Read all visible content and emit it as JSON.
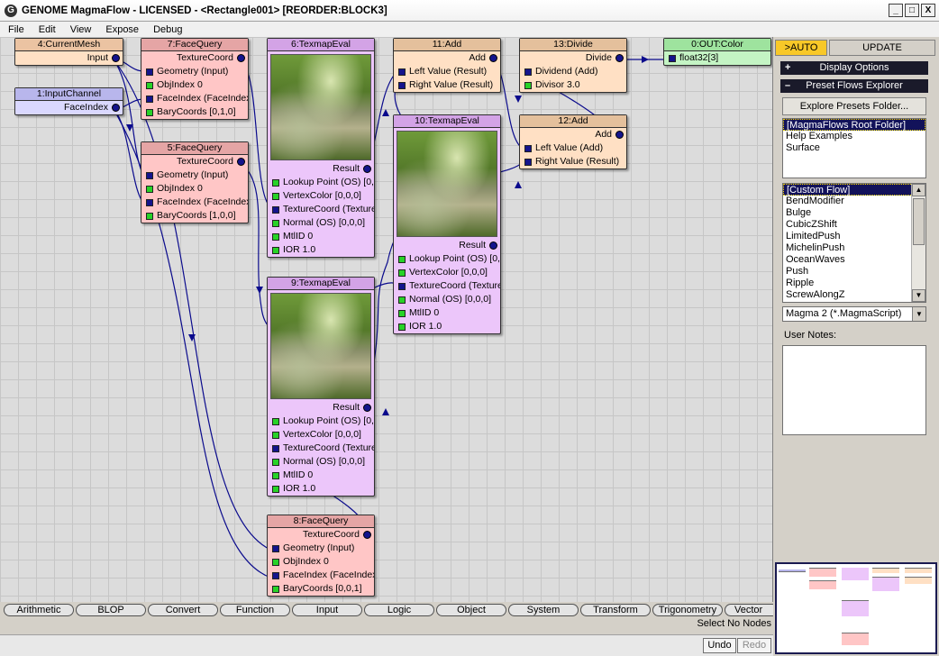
{
  "window": {
    "title": "GENOME MagmaFlow - LICENSED - <Rectangle001> [REORDER:BLOCK3]",
    "app_icon": "G",
    "minimize_glyph": "_",
    "maximize_glyph": "□",
    "close_glyph": "X"
  },
  "menu": [
    "File",
    "Edit",
    "View",
    "Expose",
    "Debug"
  ],
  "colors": {
    "mesh_node": "#ffe0c4",
    "mesh_header": "#ebc3a2",
    "input_node": "#dad8ff",
    "input_header": "#b8b6ec",
    "query_node": "#ffc6c6",
    "query_header": "#e5a5a5",
    "texmap_node": "#ecc6fa",
    "texmap_header": "#d3a3e6",
    "math_node": "#ffe0c4",
    "math_header": "#e4c09c",
    "out_node": "#c4f4c4",
    "out_header": "#9ee39e",
    "wire": "#0a0a8c"
  },
  "nodes": {
    "current_mesh": {
      "title": "4:CurrentMesh",
      "out": "Input"
    },
    "input_channel": {
      "title": "1:InputChannel",
      "out": "FaceIndex"
    },
    "facequery7": {
      "title": "7:FaceQuery",
      "out": "TextureCoord",
      "inputs": [
        {
          "label": "Geometry (Input)",
          "type": "blue"
        },
        {
          "label": "ObjIndex 0",
          "type": "green"
        },
        {
          "label": "FaceIndex (FaceIndex)",
          "type": "blue"
        },
        {
          "label": "BaryCoords [0,1,0]",
          "type": "green"
        }
      ]
    },
    "facequery5": {
      "title": "5:FaceQuery",
      "out": "TextureCoord",
      "inputs": [
        {
          "label": "Geometry (Input)",
          "type": "blue"
        },
        {
          "label": "ObjIndex 0",
          "type": "green"
        },
        {
          "label": "FaceIndex (FaceIndex)",
          "type": "blue"
        },
        {
          "label": "BaryCoords [1,0,0]",
          "type": "green"
        }
      ]
    },
    "facequery8": {
      "title": "8:FaceQuery",
      "out": "TextureCoord",
      "inputs": [
        {
          "label": "Geometry (Input)",
          "type": "blue"
        },
        {
          "label": "ObjIndex 0",
          "type": "green"
        },
        {
          "label": "FaceIndex (FaceIndex)",
          "type": "blue"
        },
        {
          "label": "BaryCoords [0,0,1]",
          "type": "green"
        }
      ]
    },
    "texmap6": {
      "title": "6:TexmapEval",
      "out": "Result",
      "inputs": [
        {
          "label": "Lookup Point (OS) [0,0,0]",
          "type": "green"
        },
        {
          "label": "VertexColor [0,0,0]",
          "type": "green"
        },
        {
          "label": "TextureCoord (TextureCoord)",
          "type": "blue"
        },
        {
          "label": "Normal (OS) [0,0,0]",
          "type": "green"
        },
        {
          "label": "MtlID 0",
          "type": "green"
        },
        {
          "label": "IOR 1.0",
          "type": "green"
        }
      ]
    },
    "texmap9": {
      "title": "9:TexmapEval",
      "out": "Result",
      "inputs": [
        {
          "label": "Lookup Point (OS) [0,0,0]",
          "type": "green"
        },
        {
          "label": "VertexColor [0,0,0]",
          "type": "green"
        },
        {
          "label": "TextureCoord (TextureCoord)",
          "type": "blue"
        },
        {
          "label": "Normal (OS) [0,0,0]",
          "type": "green"
        },
        {
          "label": "MtlID 0",
          "type": "green"
        },
        {
          "label": "IOR 1.0",
          "type": "green"
        }
      ]
    },
    "texmap10": {
      "title": "10:TexmapEval",
      "out": "Result",
      "inputs": [
        {
          "label": "Lookup Point (OS) [0,0,0]",
          "type": "green"
        },
        {
          "label": "VertexColor [0,0,0]",
          "type": "green"
        },
        {
          "label": "TextureCoord (TextureCoord)",
          "type": "blue"
        },
        {
          "label": "Normal (OS) [0,0,0]",
          "type": "green"
        },
        {
          "label": "MtlID 0",
          "type": "green"
        },
        {
          "label": "IOR 1.0",
          "type": "green"
        }
      ]
    },
    "add11": {
      "title": "11:Add",
      "out": "Add",
      "inputs": [
        {
          "label": "Left Value (Result)",
          "type": "blue"
        },
        {
          "label": "Right Value (Result)",
          "type": "blue"
        }
      ]
    },
    "add12": {
      "title": "12:Add",
      "out": "Add",
      "inputs": [
        {
          "label": "Left Value (Add)",
          "type": "blue"
        },
        {
          "label": "Right Value (Result)",
          "type": "blue"
        }
      ]
    },
    "divide13": {
      "title": "13:Divide",
      "out": "Divide",
      "inputs": [
        {
          "label": "Dividend (Add)",
          "type": "blue"
        },
        {
          "label": "Divisor 3.0",
          "type": "green"
        }
      ]
    },
    "out0": {
      "title": "0:OUT:Color",
      "inputs": [
        {
          "label": "float32[3]",
          "type": "blue"
        }
      ]
    }
  },
  "categories": [
    "Arithmetic",
    "BLOP",
    "Convert",
    "Function",
    "Input",
    "Logic",
    "Object",
    "System",
    "Transform",
    "Trigonometry",
    "Vector"
  ],
  "status": "Select No Nodes",
  "undo_label": "Undo",
  "redo_label": "Redo",
  "panel": {
    "auto_label": ">AUTO",
    "update_label": "UPDATE",
    "display_options": "Display Options",
    "preset_explorer": "Preset Flows Explorer",
    "plus": "+",
    "minus": "–",
    "explore_button": "Explore Presets Folder...",
    "folders": [
      "[MagmaFlows Root Folder]",
      "Help Examples",
      "Surface"
    ],
    "presets": [
      "[Custom Flow]",
      "BendModifier",
      "Bulge",
      "CubicZShift",
      "LimitedPush",
      "MichelinPush",
      "OceanWaves",
      "Push",
      "Ripple",
      "ScrewAlongZ"
    ],
    "filetype": "Magma 2 (*.MagmaScript)",
    "user_notes_label": "User Notes:"
  }
}
